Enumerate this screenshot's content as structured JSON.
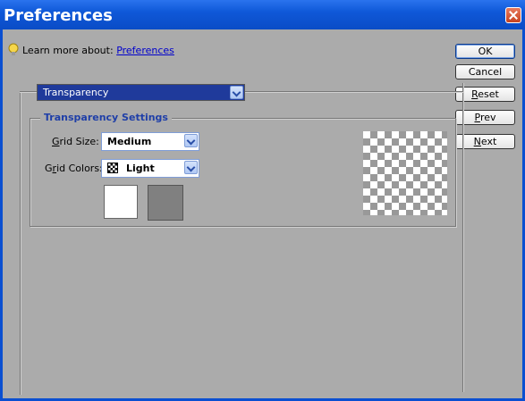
{
  "window": {
    "title": "Preferences"
  },
  "learn": {
    "prefix": "Learn more about:",
    "link": "Preferences"
  },
  "buttons": {
    "ok": "OK",
    "cancel": "Cancel",
    "reset_hot": "R",
    "reset_rest": "eset",
    "prev_hot": "P",
    "prev_rest": "rev",
    "next_hot": "N",
    "next_rest": "ext"
  },
  "section_dropdown": {
    "selected": "Transparency"
  },
  "transparency_settings": {
    "legend": "Transparency Settings",
    "grid_size": {
      "label_hot": "G",
      "label_rest": "rid Size:",
      "value": "Medium"
    },
    "grid_colors": {
      "label_a": "G",
      "label_hot": "r",
      "label_rest": "id Colors:",
      "value": "Light"
    }
  },
  "colors": {
    "title_bar": "#0a4fd1",
    "background": "#ababab",
    "link": "#0000cc",
    "legend": "#1f3fa8",
    "swatch_1": "#ffffff",
    "swatch_2": "#808080"
  },
  "icons": [
    "lightbulb-icon",
    "close-icon",
    "chevron-down-icon",
    "checkerboard-icon"
  ]
}
